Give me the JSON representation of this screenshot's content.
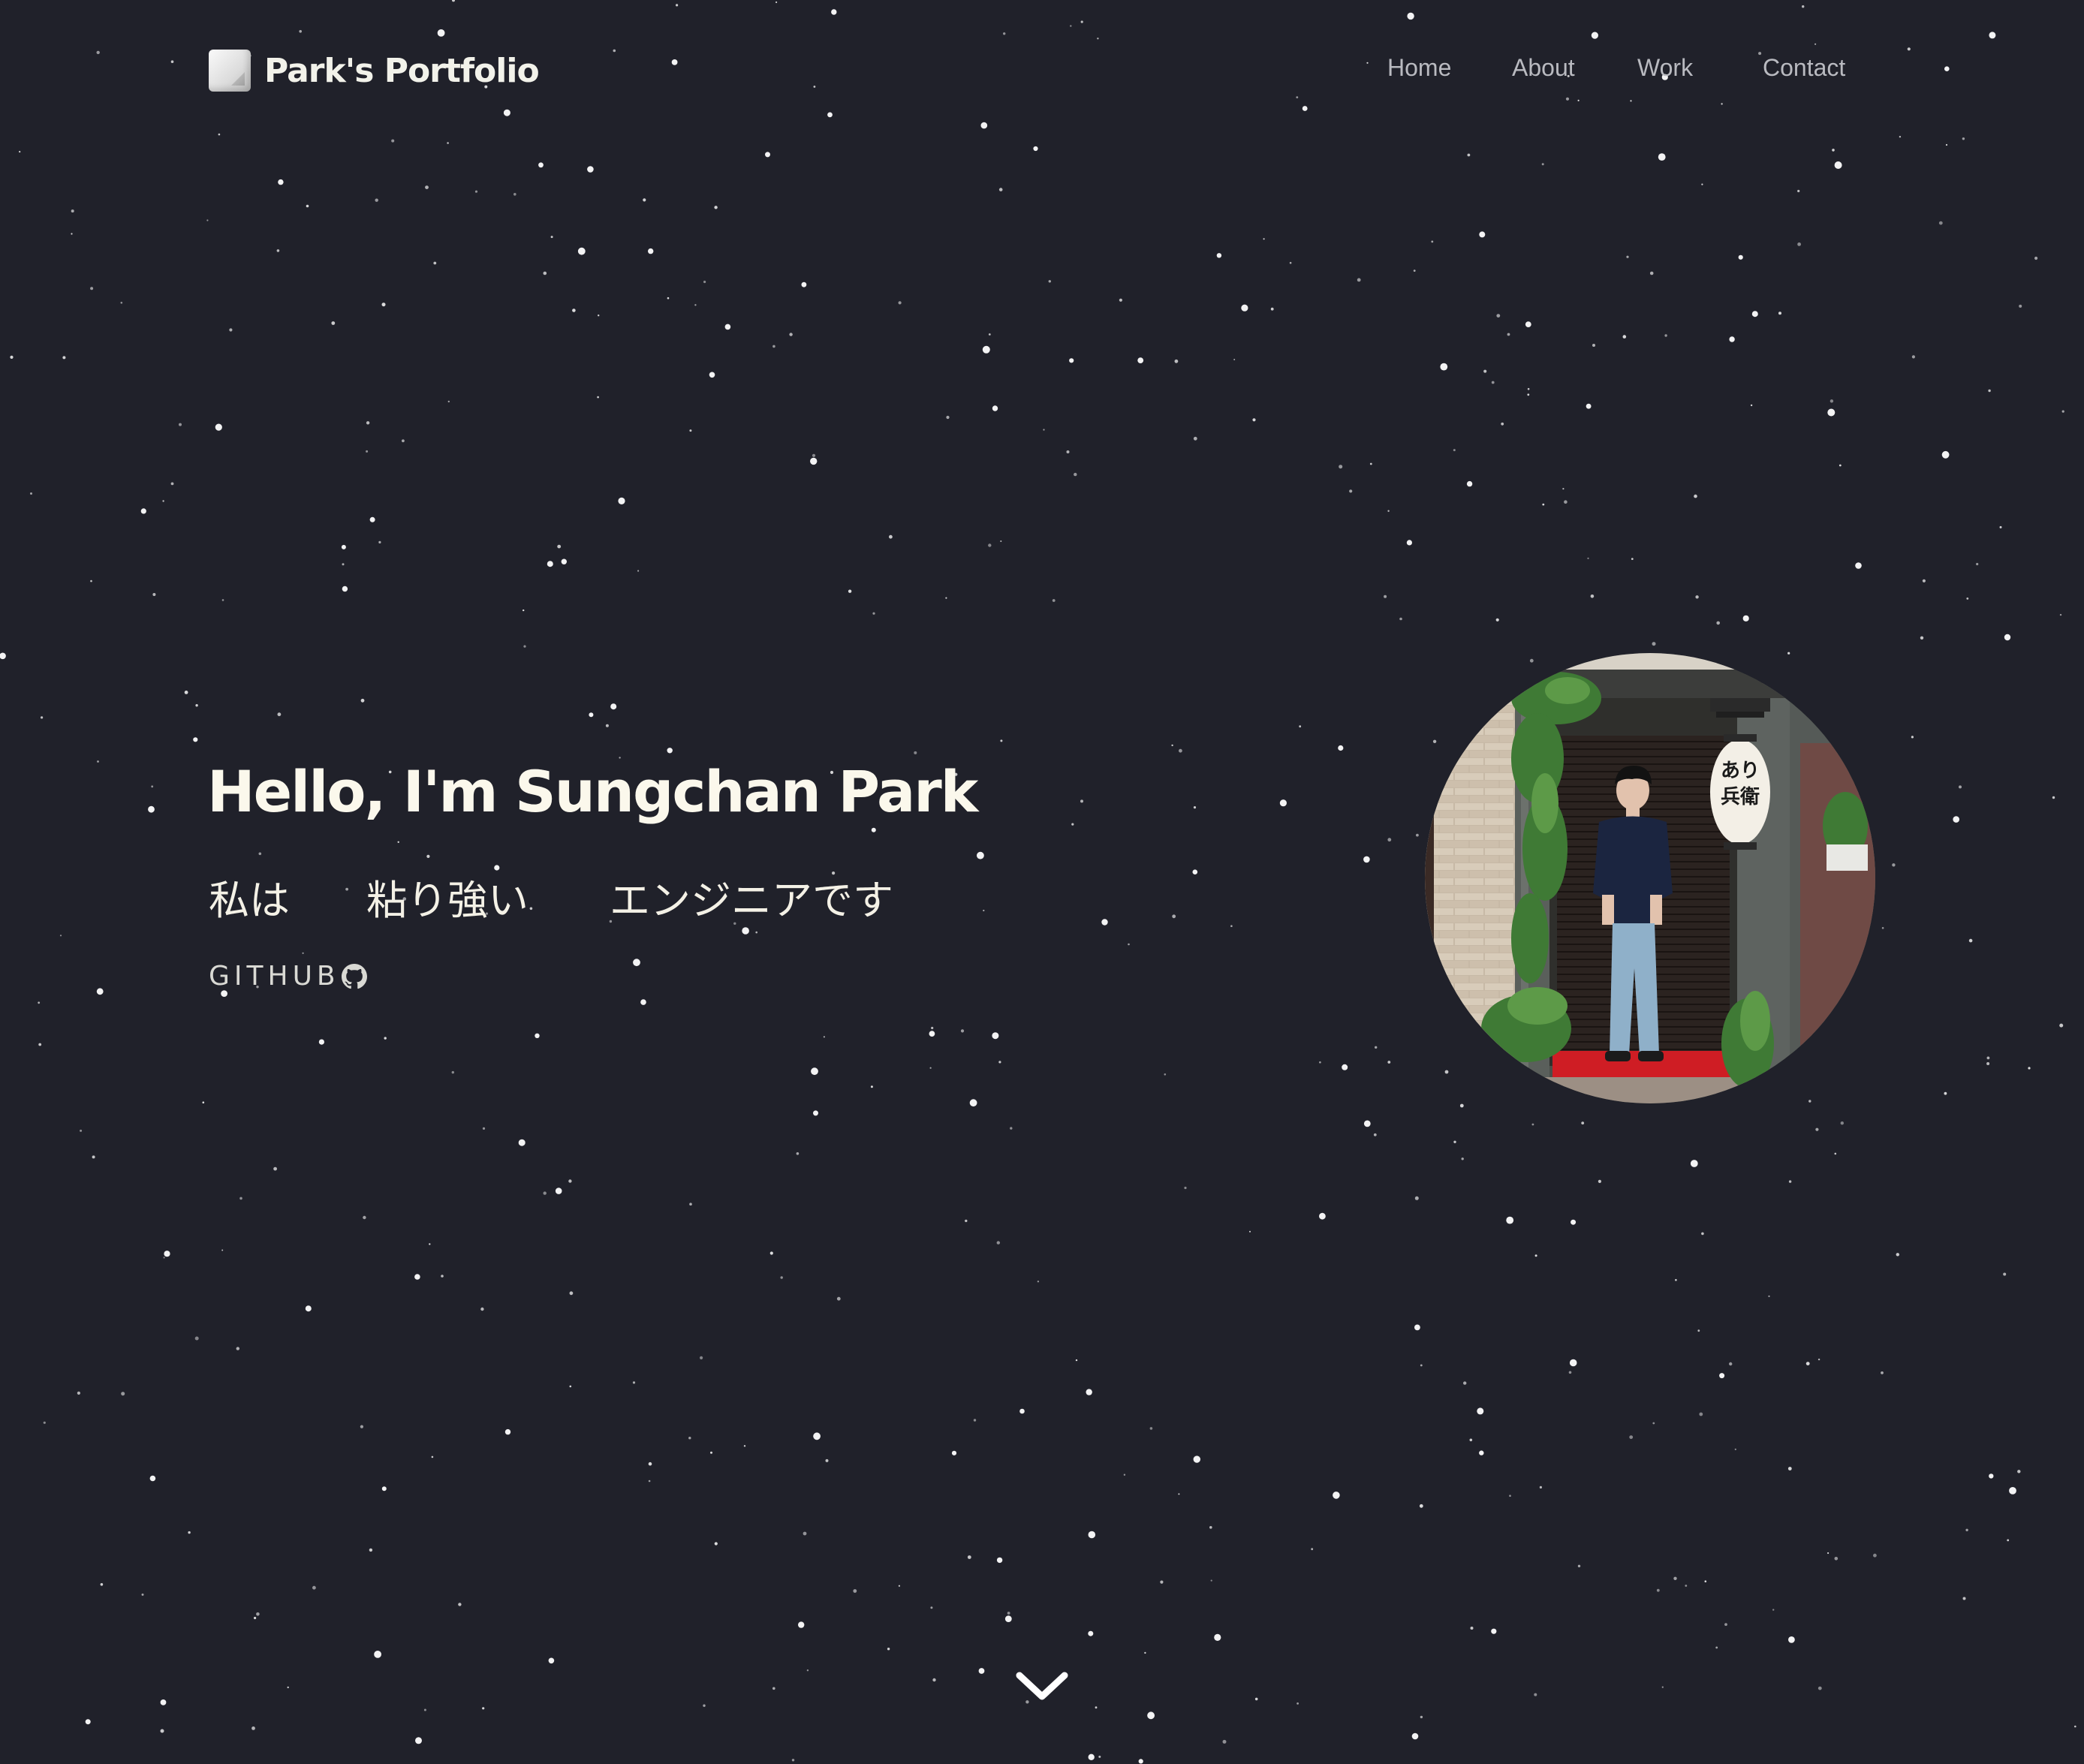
{
  "header": {
    "logo_text": "Park's Portfolio",
    "nav": [
      {
        "label": "Home"
      },
      {
        "label": "About"
      },
      {
        "label": "Work"
      },
      {
        "label": "Contact"
      }
    ]
  },
  "hero": {
    "title": "Hello, I'm Sungchan Park",
    "subtitle_words": [
      "私は",
      "粘り強い",
      "エンジニアです"
    ],
    "github_label": "GITHUB"
  },
  "profile_photo": {
    "lantern_text": "あり兵衛"
  },
  "colors": {
    "background": "#20212a",
    "title": "#fbf8ec",
    "nav_text": "#b9bac0",
    "star": "#ffffff"
  },
  "icons": {
    "logo": "document-icon",
    "github": "github-icon",
    "scroll": "chevron-down-icon"
  }
}
